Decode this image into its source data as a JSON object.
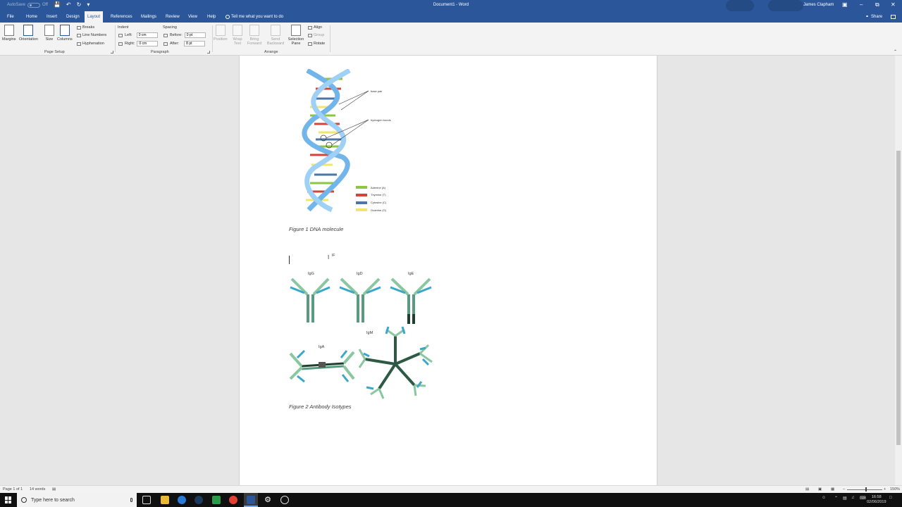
{
  "window": {
    "autosave_label": "AutoSave",
    "autosave_state": "Off",
    "doc_title": "Document1 - Word",
    "user_name": "James Clapham",
    "qat_icons": [
      "save-icon",
      "undo-icon",
      "redo-icon",
      "customize-icon"
    ]
  },
  "tabs": [
    "File",
    "Home",
    "Insert",
    "Design",
    "Layout",
    "References",
    "Mailings",
    "Review",
    "View",
    "Help"
  ],
  "active_tab": "Layout",
  "tell_me": "Tell me what you want to do",
  "share_label": "Share",
  "ribbon": {
    "page_setup": {
      "title": "Page Setup",
      "margins": "Margins",
      "orientation": "Orientation",
      "size": "Size",
      "columns": "Columns",
      "breaks": "Breaks",
      "line_numbers": "Line Numbers",
      "hyphenation": "Hyphenation"
    },
    "paragraph": {
      "title": "Paragraph",
      "indent_label": "Indent",
      "spacing_label": "Spacing",
      "left_label": "Left:",
      "left_value": "0 cm",
      "right_label": "Right:",
      "right_value": "0 cm",
      "before_label": "Before:",
      "before_value": "0 pt",
      "after_label": "After:",
      "after_value": "8 pt"
    },
    "arrange": {
      "title": "Arrange",
      "position": "Position",
      "wrap_text": "Wrap Text",
      "bring_forward": "Bring Forward",
      "send_backward": "Send Backward",
      "selection_pane": "Selection Pane",
      "align": "Align",
      "group": "Group",
      "rotate": "Rotate"
    }
  },
  "document": {
    "dna_labels": {
      "base_pair": "base pair",
      "hydrogen_bonds": "hydrogen bonds",
      "legend": [
        "Adenine (A)",
        "Thymine (T)",
        "Cytosine (C)",
        "Guanine (G)"
      ],
      "legend_colors": [
        "#8dc63f",
        "#d0463a",
        "#4a76a8",
        "#f2e56b"
      ]
    },
    "figure1_caption": "Figure 1 DNA molecule",
    "typed_text": "IF",
    "antibodies": [
      "IgG",
      "IgD",
      "IgE",
      "IgA",
      "IgM"
    ],
    "figure2_caption": "Figure 2 Antibody Isotypes"
  },
  "status": {
    "page": "Page 1 of 1",
    "words": "14 words",
    "zoom": "150%"
  },
  "taskbar": {
    "search_placeholder": "Type here to search",
    "time": "16:58",
    "date": "02/06/2019"
  }
}
